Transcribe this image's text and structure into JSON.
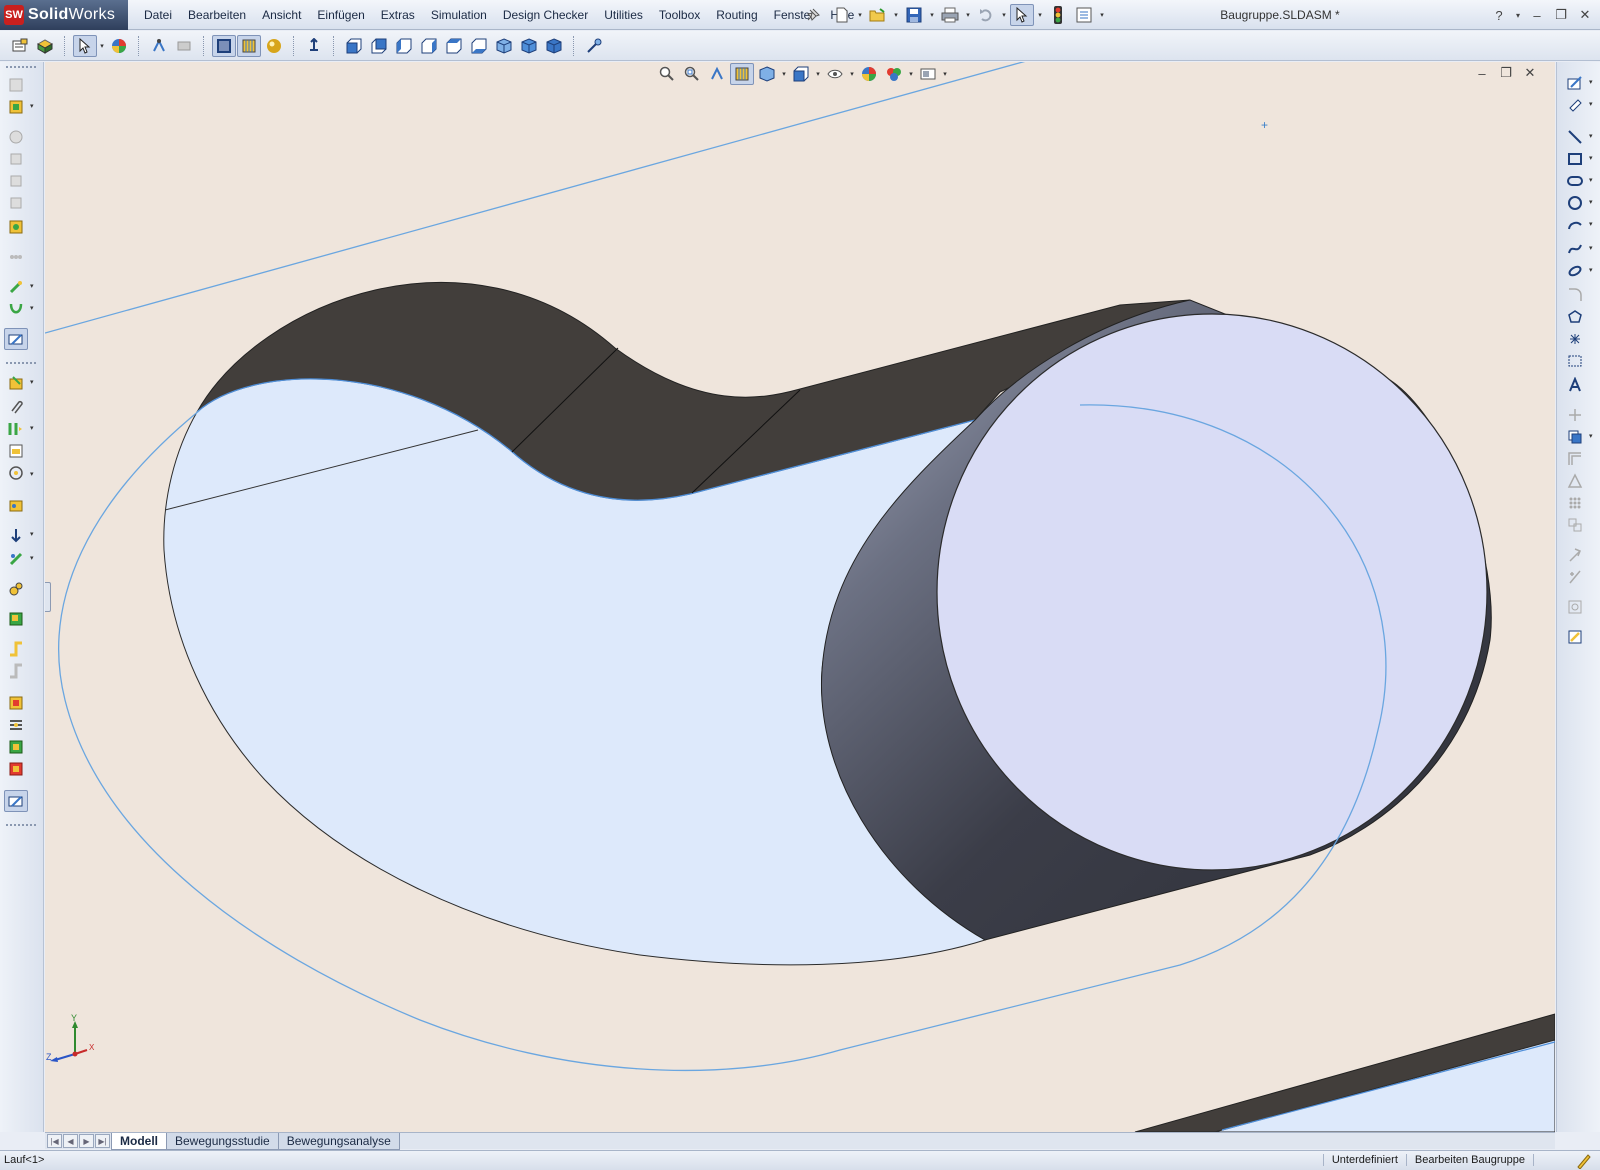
{
  "app": {
    "logo_mark": "SW",
    "logo_bold": "Solid",
    "logo_light": "Works"
  },
  "menu": {
    "items": [
      "Datei",
      "Bearbeiten",
      "Ansicht",
      "Einfügen",
      "Extras",
      "Simulation",
      "Design Checker",
      "Utilities",
      "Toolbox",
      "Routing",
      "Fenster",
      "Hilfe"
    ]
  },
  "window": {
    "title": "Baugruppe.SLDASM *",
    "help": "?",
    "minimize": "–",
    "restore": "❐",
    "close": "✕"
  },
  "viewport_controls": {
    "minimize": "–",
    "restore": "❐",
    "close": "✕"
  },
  "triad": {
    "x": "X",
    "y": "Y",
    "z": "Z"
  },
  "tabs": {
    "items": [
      {
        "label": "Modell",
        "active": true
      },
      {
        "label": "Bewegungsstudie",
        "active": false
      },
      {
        "label": "Bewegungsanalyse",
        "active": false
      }
    ]
  },
  "status": {
    "left": "Lauf<1>",
    "segments": [
      "Unterdefiniert",
      "Bearbeiten Baugruppe"
    ]
  },
  "colors": {
    "viewport_bg": "#efe5dc",
    "face_light": "#dde9fb",
    "face_dark": "#423e3b",
    "sketch_blue": "#6aa6e0",
    "accent": "#c8201e"
  }
}
